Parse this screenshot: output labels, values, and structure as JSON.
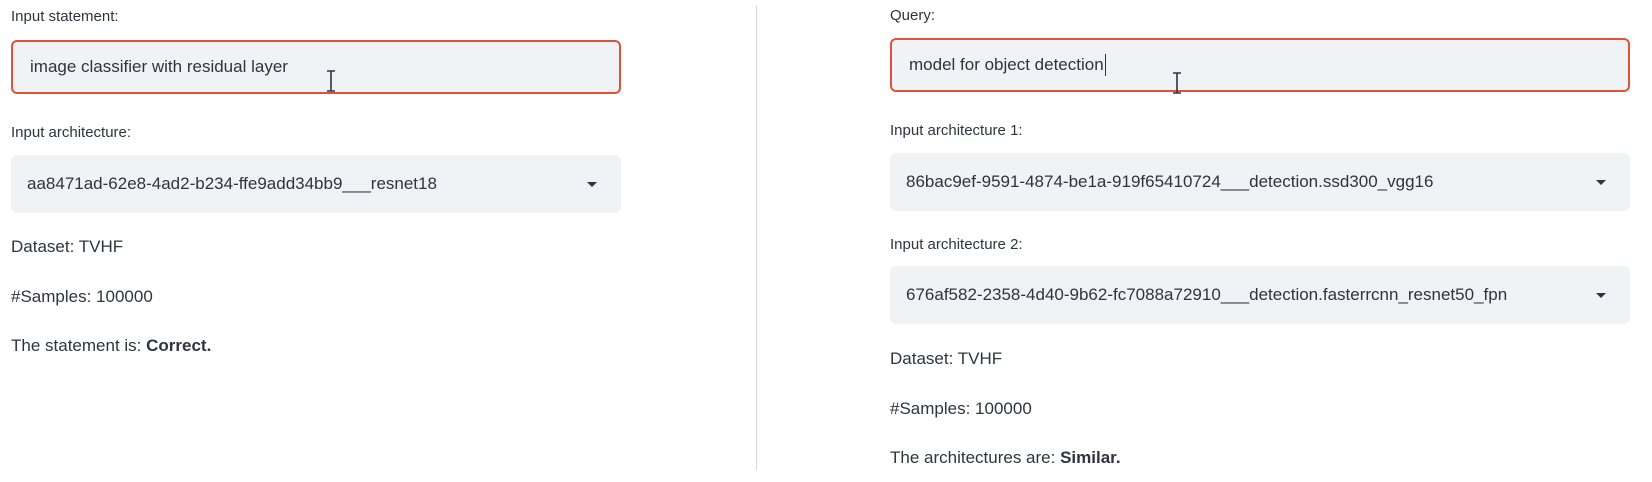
{
  "left": {
    "statement_label": "Input statement:",
    "statement_value": "image classifier with residual layer",
    "architecture_label": "Input architecture:",
    "architecture_value": "aa8471ad-62e8-4ad2-b234-ffe9add34bb9___resnet18",
    "dataset_prefix": "Dataset: ",
    "dataset_value": "TVHF",
    "samples_prefix": "#Samples: ",
    "samples_value": "100000",
    "result_prefix": "The statement is: ",
    "result_value": "Correct."
  },
  "right": {
    "query_label": "Query:",
    "query_value": "model for object detection",
    "architecture1_label": "Input architecture 1:",
    "architecture1_value": "86bac9ef-9591-4874-be1a-919f65410724___detection.ssd300_vgg16",
    "architecture2_label": "Input architecture 2:",
    "architecture2_value": "676af582-2358-4d40-9b62-fc7088a72910___detection.fasterrcnn_resnet50_fpn",
    "dataset_prefix": "Dataset: ",
    "dataset_value": "TVHF",
    "samples_prefix": "#Samples: ",
    "samples_value": "100000",
    "result_prefix": "The architectures are: ",
    "result_value": "Similar."
  },
  "colors": {
    "input_border": "#e0533b",
    "input_background": "#f0f2f6",
    "text": "#31333f",
    "divider": "#d6d6d9"
  },
  "icons": {
    "dropdown": "chevron-down-icon",
    "cursor": "text-cursor-icon"
  }
}
